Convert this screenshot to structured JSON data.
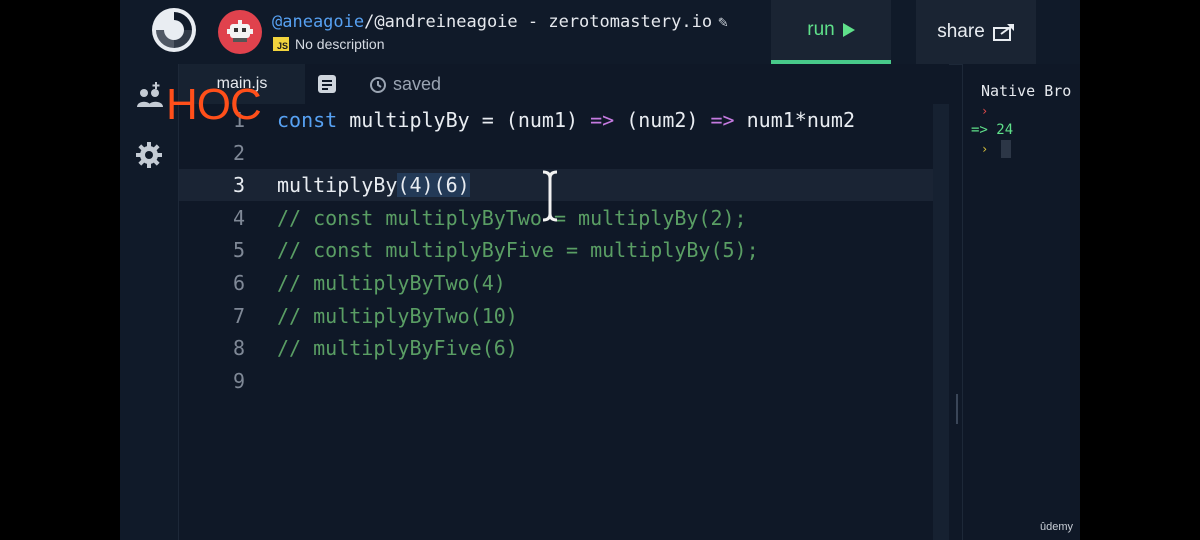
{
  "header": {
    "user": "@aneagoie",
    "repl_path": "/@andreineagoie - zerotomastery.io",
    "lang_badge": "JS",
    "description": "No description",
    "run_label": "run",
    "share_label": "share"
  },
  "tabs": {
    "file": "main.js",
    "status": "saved"
  },
  "editor": {
    "lines": [
      {
        "n": "1",
        "segments": [
          [
            "kw",
            "const "
          ],
          [
            "fn",
            "multiplyBy = (num1) "
          ],
          [
            "op",
            "=>"
          ],
          [
            "fn",
            " (num2) "
          ],
          [
            "op",
            "=>"
          ],
          [
            "fn",
            " num1*num2"
          ]
        ]
      },
      {
        "n": "2",
        "segments": []
      },
      {
        "n": "3",
        "segments": [
          [
            "fn",
            "multiplyBy"
          ],
          [
            "sel",
            "(4)(6)"
          ]
        ]
      },
      {
        "n": "4",
        "segments": [
          [
            "cm",
            "// const multiplyByTwo = multiplyBy(2);"
          ]
        ]
      },
      {
        "n": "5",
        "segments": [
          [
            "cm",
            "// const multiplyByFive = multiplyBy(5);"
          ]
        ]
      },
      {
        "n": "6",
        "segments": [
          [
            "cm",
            "// multiplyByTwo(4)"
          ]
        ]
      },
      {
        "n": "7",
        "segments": [
          [
            "cm",
            "// multiplyByTwo(10)"
          ]
        ]
      },
      {
        "n": "8",
        "segments": [
          [
            "cm",
            "// multiplyByFive(6)"
          ]
        ]
      },
      {
        "n": "9",
        "segments": []
      }
    ],
    "active_line": "3"
  },
  "console": {
    "title": "Native Bro",
    "prompt_symbol": "›",
    "result": "=> 24"
  },
  "overlay": {
    "watermark": "HOC",
    "brand": "ûdemy"
  },
  "colors": {
    "accent_run": "#5fe08a",
    "keyword": "#57a1f2",
    "arrow": "#c57ae0",
    "comment": "#5a9e64",
    "avatar_bg": "#e0424d"
  },
  "icons": [
    "replit-logo-icon",
    "avatar-icon",
    "pencil-icon",
    "play-icon",
    "share-icon",
    "add-user-icon",
    "gear-icon",
    "document-icon",
    "history-icon"
  ]
}
